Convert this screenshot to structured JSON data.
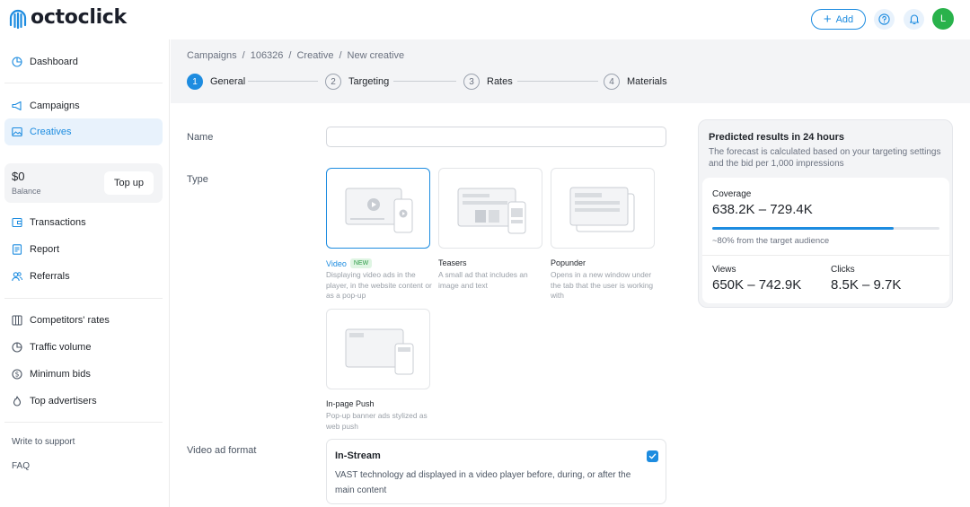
{
  "app": {
    "logo_text": "octoclick",
    "add_label": "Add",
    "avatar_initial": "L",
    "colors": {
      "accent": "#1d8ce0",
      "avatar": "#29b24b",
      "new_badge": "#2e9b48"
    }
  },
  "sidebar": {
    "dashboard": "Dashboard",
    "campaigns": "Campaigns",
    "creatives": "Creatives",
    "balance_amount": "$0",
    "balance_label": "Balance",
    "topup_label": "Top up",
    "transactions": "Transactions",
    "report": "Report",
    "referrals": "Referrals",
    "competitors_rates": "Competitors' rates",
    "traffic_volume": "Traffic volume",
    "minimum_bids": "Minimum bids",
    "top_advertisers": "Top advertisers",
    "write_support": "Write to support",
    "faq": "FAQ"
  },
  "breadcrumb": [
    "Campaigns",
    "/",
    "106326",
    "/",
    "Creative",
    "/",
    "New creative"
  ],
  "steps": [
    {
      "num": "1",
      "label": "General"
    },
    {
      "num": "2",
      "label": "Targeting"
    },
    {
      "num": "3",
      "label": "Rates"
    },
    {
      "num": "4",
      "label": "Materials"
    }
  ],
  "form": {
    "name_label": "Name",
    "name_value": "",
    "type_label": "Type",
    "video_format_label": "Video ad format",
    "types": [
      {
        "title": "Video",
        "badge": "NEW",
        "desc": "Displaying video ads in the player, in the website content or as a pop-up"
      },
      {
        "title": "Teasers",
        "desc": "A small ad that includes an image and text"
      },
      {
        "title": "Popunder",
        "desc": "Opens in a new window under the tab that the user is working with"
      },
      {
        "title": "In-page Push",
        "desc": "Pop-up banner ads stylized as web push"
      }
    ],
    "instream": {
      "title": "In-Stream",
      "desc": "VAST technology ad displayed in a video player before, during, or after the main content",
      "checked": true
    }
  },
  "forecast": {
    "title": "Predicted results in 24 hours",
    "desc": "The forecast is calculated based on your targeting settings and the bid per 1,000 impressions",
    "coverage_label": "Coverage",
    "coverage_value": "638.2K – 729.4K",
    "coverage_fraction": 0.8,
    "coverage_note": "~80% from the target audience",
    "views_label": "Views",
    "views_value": "650K – 742.9K",
    "clicks_label": "Clicks",
    "clicks_value": "8.5K – 9.7K"
  }
}
